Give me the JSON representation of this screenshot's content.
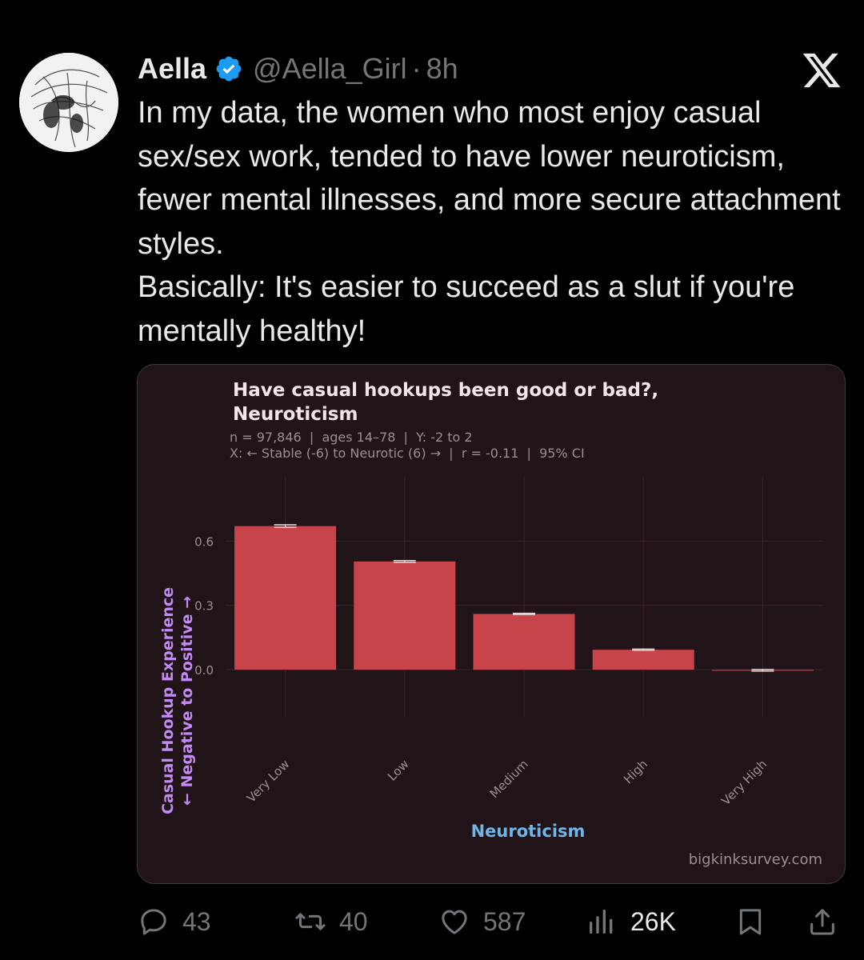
{
  "tweet": {
    "author_name": "Aella",
    "handle": "@Aella_Girl",
    "separator": "·",
    "time": "8h",
    "text_lines": [
      "In my data, the women who most enjoy casual sex/sex work, tended to have lower neuroticism, fewer mental illnesses, and more secure attachment styles.",
      "Basically: It's easier to succeed as a slut if you're mentally healthy!"
    ]
  },
  "icons": {
    "avatar": "avatar-sketch-portrait",
    "verified": "verified-badge-icon",
    "brand": "x-logo-icon"
  },
  "colors": {
    "background": "#000000",
    "text": "#e7e9ea",
    "muted": "#71767b",
    "verified": "#1d9bf0",
    "card_bg": "#211418",
    "bar": "#c7444a",
    "ylabel": "#c28af5",
    "xlabel": "#6fb6e8"
  },
  "chart_data": {
    "type": "bar",
    "title": "Have casual hookups been good or bad?,",
    "title_line2": "Neuroticism",
    "subtitle_line1": "n = 97,846  |  ages 14–78  |  Y: -2 to 2",
    "subtitle_line2": "X: ← Stable (-6) to Neurotic (6) →  |  r = -0.11  |  95% CI",
    "categories": [
      "Very Low",
      "Low",
      "Medium",
      "High",
      "Very High"
    ],
    "values": [
      0.67,
      0.505,
      0.26,
      0.093,
      -0.003
    ],
    "error": [
      0.006,
      0.004,
      0.003,
      0.003,
      0.004
    ],
    "ylim": [
      -0.22,
      0.9
    ],
    "yticks": [
      "0.6",
      "0.3",
      "0.0"
    ],
    "ylabel_line1": "Casual Hookup Experience",
    "ylabel_line2": "← Negative to Positive →",
    "xlabel": "Neuroticism",
    "source": "bigkinksurvey.com",
    "grid": true,
    "legend": "none"
  },
  "actions": {
    "replies": "43",
    "reposts": "40",
    "likes": "587",
    "views": "26K"
  }
}
